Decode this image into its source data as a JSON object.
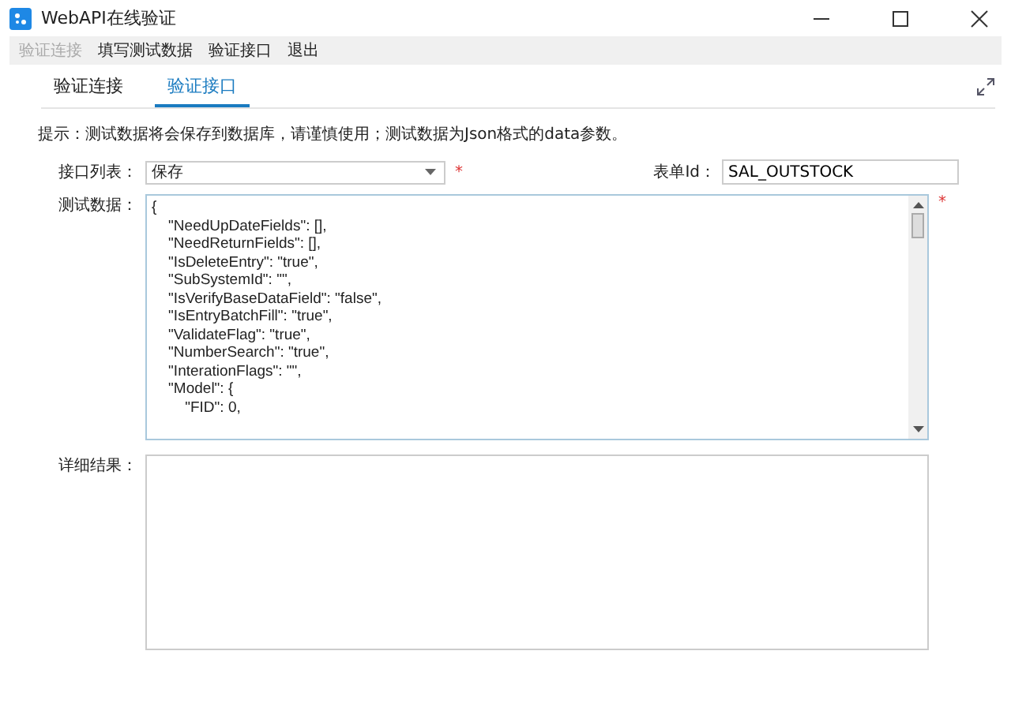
{
  "window": {
    "title": "WebAPI在线验证"
  },
  "menu": [
    {
      "label": "验证连接",
      "disabled": true
    },
    {
      "label": "填写测试数据",
      "disabled": false
    },
    {
      "label": "验证接口",
      "disabled": false
    },
    {
      "label": "退出",
      "disabled": false
    }
  ],
  "tabs": [
    {
      "label": "验证连接",
      "selected": false
    },
    {
      "label": "验证接口",
      "selected": true
    }
  ],
  "hint": "提示：测试数据将会保存到数据库，请谨慎使用；测试数据为Json格式的data参数。",
  "interface_list": {
    "label": "接口列表：",
    "value": "保存",
    "required_mark": "*"
  },
  "form_id": {
    "label": "表单Id：",
    "value": "SAL_OUTSTOCK"
  },
  "test_data": {
    "label": "测试数据：",
    "required_mark": "*",
    "value": "{\n    \"NeedUpDateFields\": [],\n    \"NeedReturnFields\": [],\n    \"IsDeleteEntry\": \"true\",\n    \"SubSystemId\": \"\",\n    \"IsVerifyBaseDataField\": \"false\",\n    \"IsEntryBatchFill\": \"true\",\n    \"ValidateFlag\": \"true\",\n    \"NumberSearch\": \"true\",\n    \"InterationFlags\": \"\",\n    \"Model\": {\n        \"FID\": 0,"
  },
  "result": {
    "label": "详细结果："
  }
}
